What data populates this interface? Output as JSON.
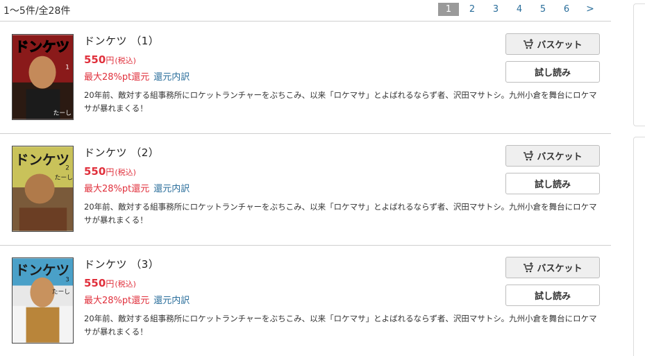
{
  "header": {
    "count_text": "1〜5件/全28件",
    "pages": [
      "1",
      "2",
      "3",
      "4",
      "5",
      "6"
    ],
    "current_page": "1",
    "next_label": ">"
  },
  "items": [
    {
      "title": "ドンケツ （1）",
      "price": "550",
      "yen": "円",
      "tax": "(税込)",
      "points": "最大28%pt還元",
      "breakdown": "還元内訳",
      "description": "20年前、敵対する組事務所にロケットランチャーをぶちこみ、以来「ロケマサ」とよばれるならず者、沢田マサトシ。九州小倉を舞台にロケマサが暴れまくる！",
      "basket_label": "バスケット",
      "trial_label": "試し読み",
      "cover_text": "ドンケツ",
      "cover_author": "たーし",
      "cover_volume": "1"
    },
    {
      "title": "ドンケツ （2）",
      "price": "550",
      "yen": "円",
      "tax": "(税込)",
      "points": "最大28%pt還元",
      "breakdown": "還元内訳",
      "description": "20年前、敵対する組事務所にロケットランチャーをぶちこみ、以来「ロケマサ」とよばれるならず者、沢田マサトシ。九州小倉を舞台にロケマサが暴れまくる！",
      "basket_label": "バスケット",
      "trial_label": "試し読み",
      "cover_text": "ドンケツ",
      "cover_author": "たーし",
      "cover_volume": "2"
    },
    {
      "title": "ドンケツ （3）",
      "price": "550",
      "yen": "円",
      "tax": "(税込)",
      "points": "最大28%pt還元",
      "breakdown": "還元内訳",
      "description": "20年前、敵対する組事務所にロケットランチャーをぶちこみ、以来「ロケマサ」とよばれるならず者、沢田マサトシ。九州小倉を舞台にロケマサが暴れまくる！",
      "basket_label": "バスケット",
      "trial_label": "試し読み",
      "cover_text": "ドンケツ",
      "cover_author": "たーし",
      "cover_volume": "3"
    }
  ],
  "colors": {
    "price_red": "#e0303c",
    "link_blue": "#2a6e9b",
    "current_page_bg": "#9a9a9a",
    "cover1_bg": "#8a1a1a",
    "cover2_bg": "#c9c25a",
    "cover3_bg": "#e8e8e8"
  },
  "icons": {
    "basket": "cart-plus-icon"
  }
}
